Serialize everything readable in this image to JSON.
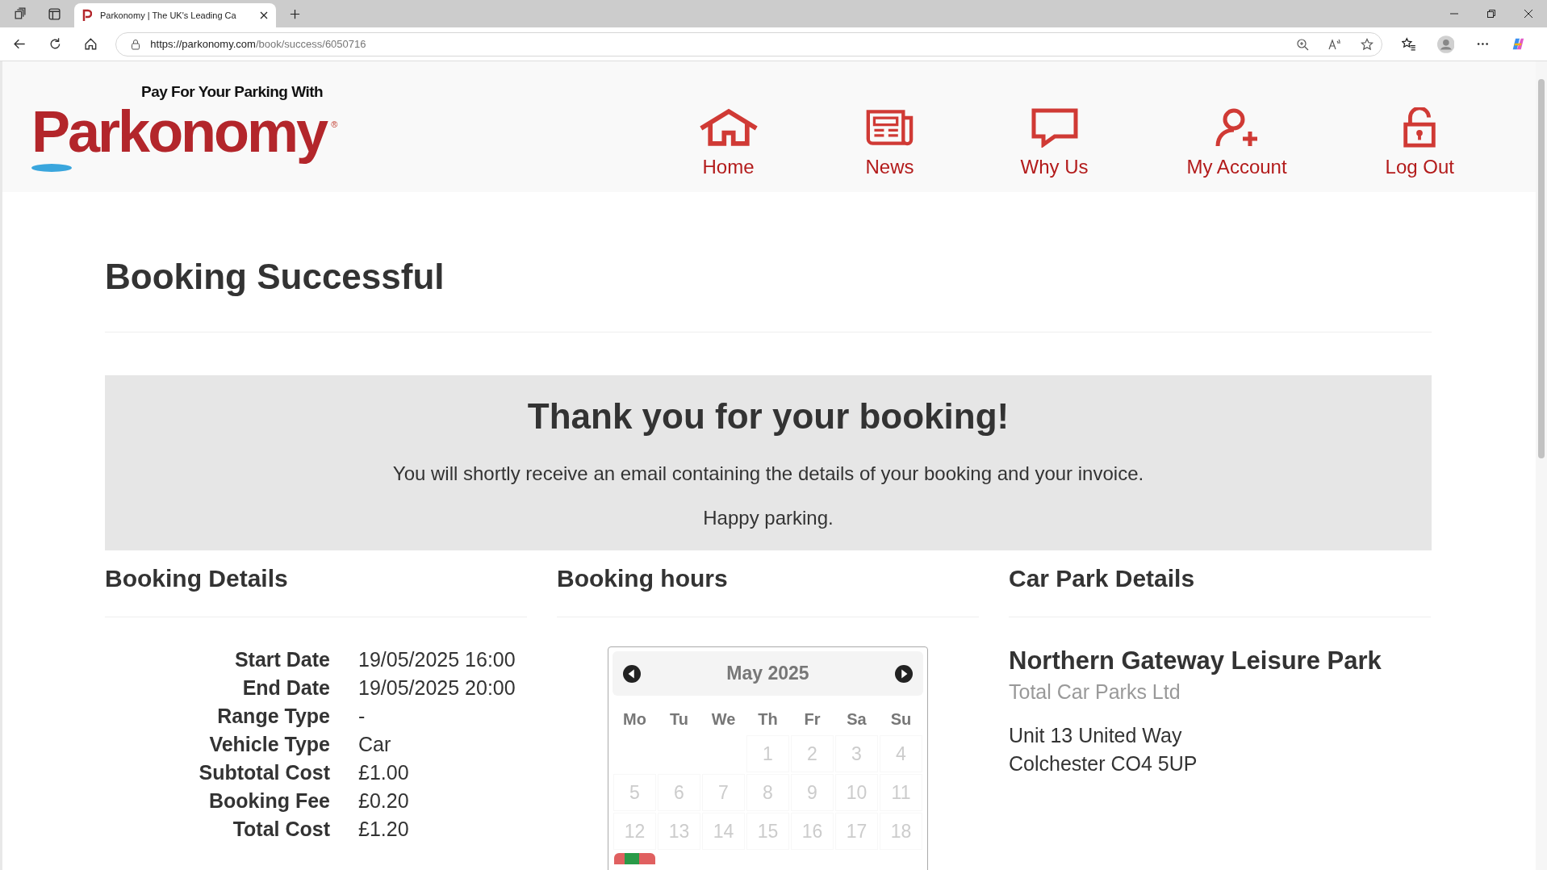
{
  "browser": {
    "tab_title": "Parkonomy | The UK's Leading Ca",
    "url_host": "https://parkonomy.com",
    "url_path": "/book/success/6050716"
  },
  "logo": {
    "tagline": "Pay For Your Parking With",
    "name": "Parkonomy",
    "mark": "®"
  },
  "nav": [
    {
      "label": "Home",
      "kind": "home"
    },
    {
      "label": "News",
      "kind": "news"
    },
    {
      "label": "Why Us",
      "kind": "chat"
    },
    {
      "label": "My Account",
      "kind": "account"
    },
    {
      "label": "Log Out",
      "kind": "logout"
    }
  ],
  "page_title": "Booking Successful",
  "alert": {
    "heading": "Thank you for your booking!",
    "message": "You will shortly receive an email containing the details of your booking and your invoice.",
    "closing": "Happy parking."
  },
  "booking_details": {
    "heading": "Booking Details",
    "rows": [
      {
        "label": "Start Date",
        "value": "19/05/2025 16:00"
      },
      {
        "label": "End Date",
        "value": "19/05/2025 20:00"
      },
      {
        "label": "Range Type",
        "value": "-"
      },
      {
        "label": "Vehicle Type",
        "value": "Car"
      },
      {
        "label": "Subtotal Cost",
        "value": "£1.00"
      },
      {
        "label": "Booking Fee",
        "value": "£0.20"
      },
      {
        "label": "Total Cost",
        "value": "£1.20"
      }
    ]
  },
  "booking_hours": {
    "heading": "Booking hours",
    "calendar": {
      "month": "May 2025",
      "weekdays": [
        "Mo",
        "Tu",
        "We",
        "Th",
        "Fr",
        "Sa",
        "Su"
      ],
      "weeks": [
        [
          "1",
          "2",
          "3",
          "4"
        ],
        [
          "5",
          "6",
          "7",
          "8",
          "9",
          "10",
          "11"
        ],
        [
          "12",
          "13",
          "14",
          "15",
          "16",
          "17",
          "18"
        ]
      ],
      "next_row_booked": true
    }
  },
  "car_park": {
    "heading": "Car Park Details",
    "name": "Northern Gateway Leisure Park",
    "operator": "Total Car Parks Ltd",
    "address": [
      "Unit 13 United Way",
      "Colchester CO4 5UP"
    ]
  }
}
